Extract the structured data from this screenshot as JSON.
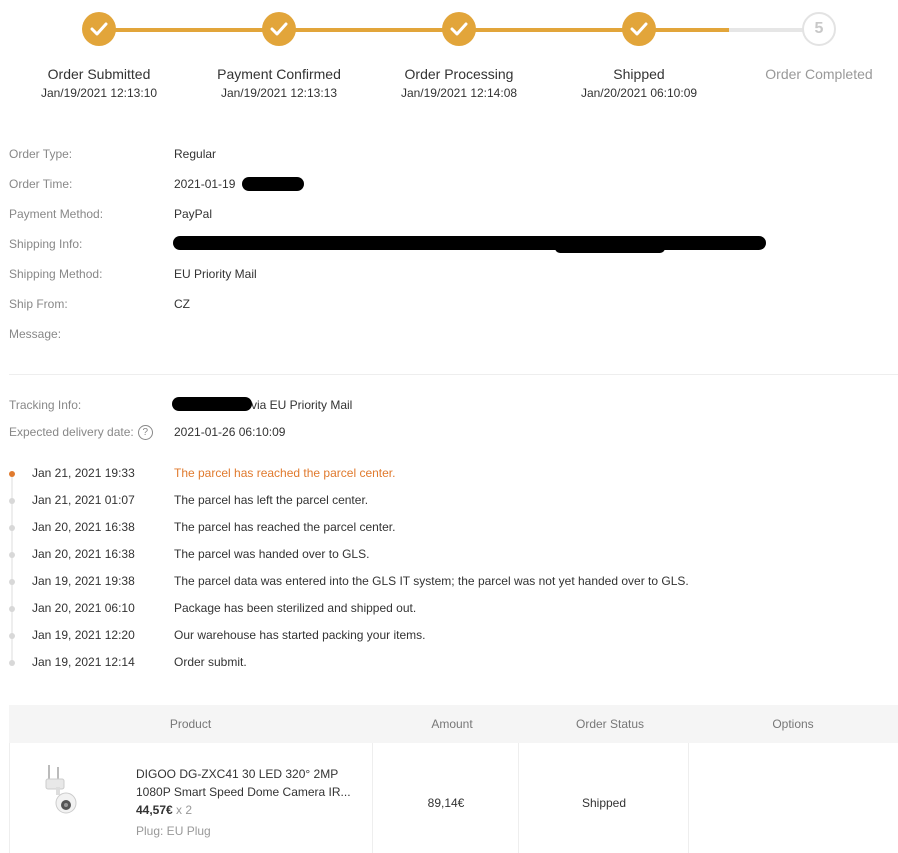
{
  "steps": [
    {
      "label": "Order Submitted",
      "time": "Jan/19/2021 12:13:10",
      "done": true
    },
    {
      "label": "Payment Confirmed",
      "time": "Jan/19/2021 12:13:13",
      "done": true
    },
    {
      "label": "Order Processing",
      "time": "Jan/19/2021 12:14:08",
      "done": true
    },
    {
      "label": "Shipped",
      "time": "Jan/20/2021 06:10:09",
      "done": true
    },
    {
      "label": "Order Completed",
      "number": "5",
      "done": false
    }
  ],
  "order": {
    "type_label": "Order Type:",
    "type_value": "Regular",
    "time_label": "Order Time:",
    "time_value": "2021-01-19",
    "payment_label": "Payment Method:",
    "payment_value": "PayPal",
    "shipping_info_label": "Shipping Info:",
    "shipping_method_label": "Shipping Method:",
    "shipping_method_value": "EU Priority Mail",
    "ship_from_label": "Ship From:",
    "ship_from_value": "CZ",
    "message_label": "Message:"
  },
  "tracking": {
    "info_label": "Tracking Info:",
    "info_value": "via EU Priority Mail",
    "expected_label": "Expected delivery date:",
    "help_icon": "?",
    "expected_value": "2021-01-26 06:10:09"
  },
  "timeline": [
    {
      "date": "Jan 21, 2021 19:33",
      "desc": "The parcel has reached the parcel center.",
      "active": true
    },
    {
      "date": "Jan 21, 2021 01:07",
      "desc": "The parcel has left the parcel center."
    },
    {
      "date": "Jan 20, 2021 16:38",
      "desc": "The parcel has reached the parcel center."
    },
    {
      "date": "Jan 20, 2021 16:38",
      "desc": "The parcel was handed over to GLS."
    },
    {
      "date": "Jan 19, 2021 19:38",
      "desc": "The parcel data was entered into the GLS IT system; the parcel was not yet handed over to GLS."
    },
    {
      "date": "Jan 20, 2021 06:10",
      "desc": "Package has been sterilized and shipped out."
    },
    {
      "date": "Jan 19, 2021 12:20",
      "desc": "Our warehouse has started packing your items."
    },
    {
      "date": "Jan 19, 2021 12:14",
      "desc": "Order submit."
    }
  ],
  "table": {
    "headers": {
      "product": "Product",
      "amount": "Amount",
      "status": "Order Status",
      "options": "Options"
    },
    "item": {
      "name": "DIGOO DG-ZXC41 30 LED 320° 2MP 1080P Smart Speed Dome Camera IR...",
      "price": "44,57€",
      "qty": "x 2",
      "plug": "Plug: EU Plug",
      "amount": "89,14€",
      "status": "Shipped"
    }
  },
  "colors": {
    "accent": "#e2a53a",
    "active_event": "#e07a2e",
    "pending": "#e6e6e6"
  }
}
